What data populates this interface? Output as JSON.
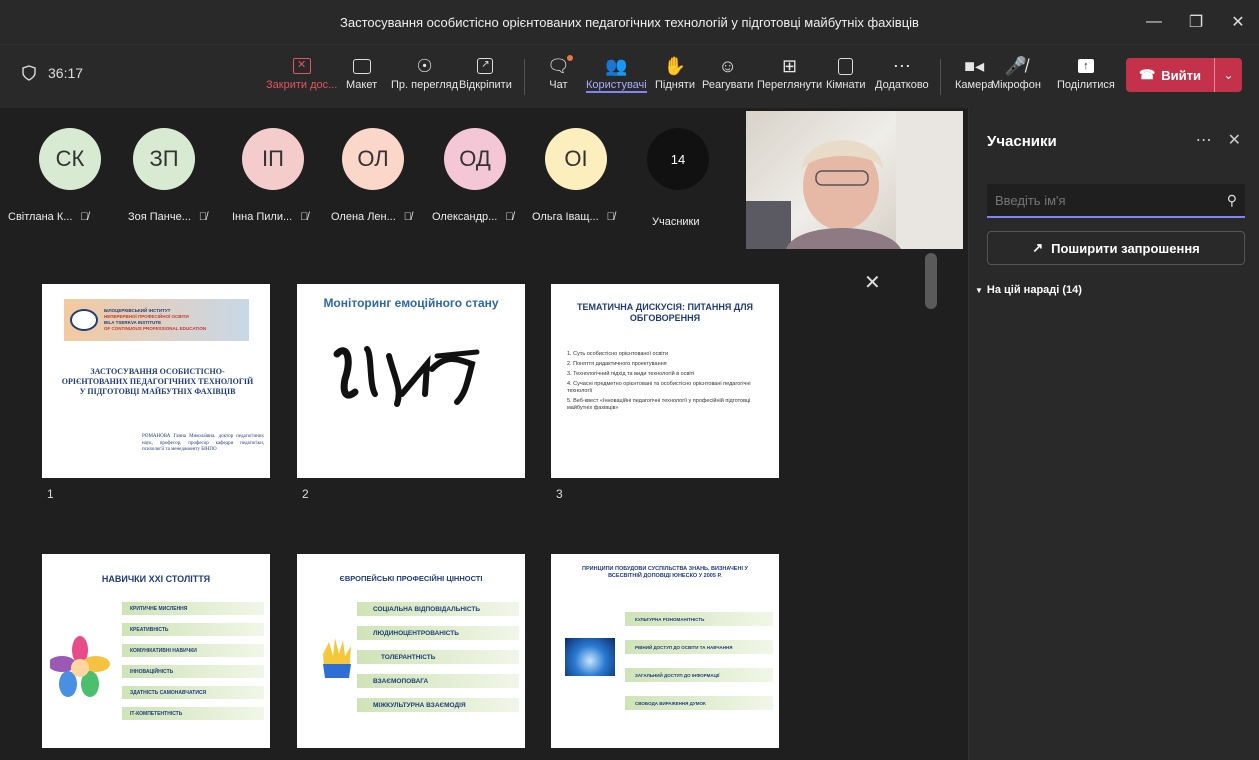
{
  "window": {
    "title": "Застосування особистісно орієнтованих педагогічних технологій у підготовці майбутніх фахівців"
  },
  "timer": "36:17",
  "toolbar": {
    "stop_share": "Закрити дос...",
    "layout": "Макет",
    "preview": "Пр. перегляд",
    "unpin": "Відкріпити",
    "chat": "Чат",
    "people": "Користувачі",
    "raise": "Підняти",
    "react": "Реагувати",
    "view": "Переглянути",
    "rooms": "Кімнати",
    "more": "Додатково",
    "camera": "Камера",
    "mic": "Мікрофон",
    "share": "Поділитися",
    "leave": "Вийти"
  },
  "participants": [
    {
      "initials": "СК",
      "name": "Світлана К...",
      "color": "#d9ead3"
    },
    {
      "initials": "ЗП",
      "name": "Зоя Панче...",
      "color": "#d9ead3"
    },
    {
      "initials": "ІП",
      "name": "Інна Пили...",
      "color": "#f4cccc"
    },
    {
      "initials": "ОЛ",
      "name": "Олена Лен...",
      "color": "#fad7c9"
    },
    {
      "initials": "ОД",
      "name": "Олександр...",
      "color": "#f4c7d6"
    },
    {
      "initials": "ОІ",
      "name": "Ольга Іващ...",
      "color": "#fdeebd"
    }
  ],
  "more_participants": {
    "count": "14",
    "label": "Учасники"
  },
  "slides": {
    "s1": {
      "num": "1",
      "inst1": "БІЛОЦЕРКІВСЬКИЙ ІНСТИТУТ",
      "inst2": "НЕПЕРЕРВНОЇ ПРОФЕСІЙНОЇ ОСВІТИ",
      "inst3": "BILA TSERKVA INSTITUTE",
      "inst4": "OF CONTINUOUS PROFESSIONAL EDUCATION",
      "title": "ЗАСТОСУВАННЯ ОСОБИСТІСНО-ОРІЄНТОВАНИХ ПЕДАГОГІЧНИХ ТЕХНОЛОГІЙ У ПІДГОТОВЦІ МАЙБУТНІХ ФАХІВЦІВ",
      "author": "РОМАНОВА Ганна Миколаївна, доктор педагогічних наук, професор, професор кафедри педагогіки, психології та менеджменту БІНПО"
    },
    "s2": {
      "num": "2",
      "title": "Моніторинг емоційного стану"
    },
    "s3": {
      "num": "3",
      "title": "ТЕМАТИЧНА ДИСКУСІЯ: ПИТАННЯ ДЛЯ ОБГОВОРЕННЯ",
      "items": [
        "1. Суть особистісно орієнтованої освіти",
        "2. Поняття дидактичного проектування",
        "3. Технологічний підхід та види технологій в освіті",
        "4. Сучасні предметно орієнтовані та особистісно орієнтовані педагогічні технології",
        "5. Веб-квест «Інноваційні педагогічні технології у професійній підготовці майбутніх фахівців»"
      ]
    },
    "s4": {
      "title": "НАВИЧКИ XXI СТОЛІТТЯ",
      "items": [
        "КРИТИЧНЕ МИСЛЕННЯ",
        "КРЕАТИВНІСТЬ",
        "КОМУНІКАТИВНІ НАВИЧКИ",
        "ІННОВАЦІЙНІСТЬ",
        "ЗДАТНІСТЬ САМОНАВЧАТИСЯ",
        "ІТ-КОМПЕТЕНТНІСТЬ"
      ]
    },
    "s5": {
      "title": "ЄВРОПЕЙСЬКІ ПРОФЕСІЙНІ ЦІННОСТІ",
      "items": [
        "СОЦІАЛЬНА ВІДПОВІДАЛЬНІСТЬ",
        "ЛЮДИНОЦЕНТРОВАНІСТЬ",
        "ТОЛЕРАНТНІСТЬ",
        "ВЗАЄМОПОВАГА",
        "МІЖКУЛЬТУРНА ВЗАЄМОДІЯ"
      ]
    },
    "s6": {
      "title": "ПРИНЦИПИ ПОБУДОВИ СУСПІЛЬСТВА ЗНАНЬ, ВИЗНАЧЕНІ У ВСЕСВІТНІЙ ДОПОВІДІ ЮНЕСКО У 2005 Р.",
      "items": [
        "КУЛЬТУРНА РІЗНОМАНІТНІСТЬ",
        "РІВНИЙ ДОСТУП ДО ОСВІТИ ТА НАВЧАННЯ",
        "ЗАГАЛЬНИЙ ДОСТУП ДО ІНФОРМАЦІЇ",
        "СВОБОДА ВИРАЖЕННЯ ДУМОК"
      ]
    }
  },
  "panel": {
    "title": "Учасники",
    "search_placeholder": "Введіть ім'я",
    "invite": "Поширити запрошення",
    "section": "На цій нараді (14)"
  }
}
